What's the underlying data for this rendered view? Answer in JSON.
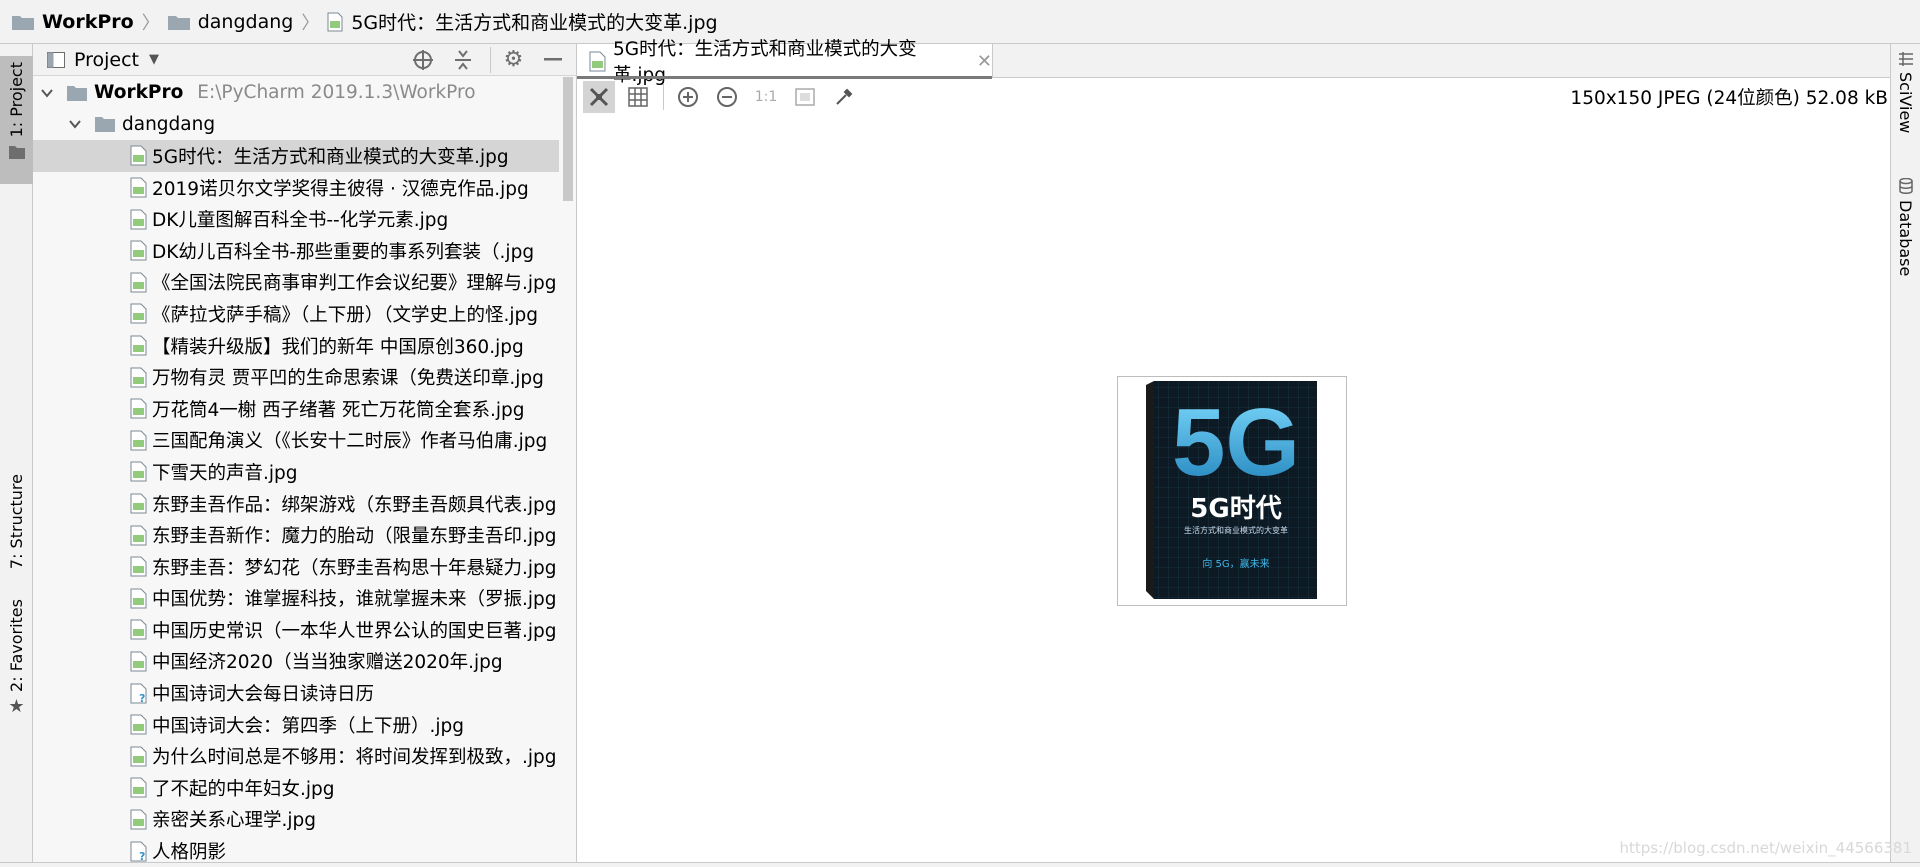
{
  "breadcrumb": {
    "items": [
      "WorkPro",
      "dangdang",
      "5G时代：生活方式和商业模式的大变革.jpg"
    ]
  },
  "left_stripe": {
    "project": "1: Project",
    "structure": "7: Structure",
    "favorites": "2: Favorites"
  },
  "right_stripe": {
    "sciview": "SciView",
    "database": "Database"
  },
  "project_panel": {
    "title": "Project",
    "root_name": "WorkPro",
    "root_path": "E:\\PyCharm 2019.1.3\\WorkPro",
    "folder": "dangdang",
    "files": [
      "5G时代：生活方式和商业模式的大变革.jpg",
      "2019诺贝尔文学奖得主彼得 · 汉德克作品.jpg",
      "DK儿童图解百科全书--化学元素.jpg",
      "DK幼儿百科全书-那些重要的事系列套装（.jpg",
      "《全国法院民商事审判工作会议纪要》理解与.jpg",
      "《萨拉戈萨手稿》（上下册）（文学史上的怪.jpg",
      "【精装升级版】我们的新年 中国原创360.jpg",
      "万物有灵 贾平凹的生命思索课（免费送印章.jpg",
      "万花筒4一榭 西子绪著 死亡万花筒全套系.jpg",
      "三国配角演义（《长安十二时辰》作者马伯庸.jpg",
      "下雪天的声音.jpg",
      "东野圭吾作品：绑架游戏（东野圭吾颇具代表.jpg",
      "东野圭吾新作：魔力的胎动（限量东野圭吾印.jpg",
      "东野圭吾：梦幻花（东野圭吾构思十年悬疑力.jpg",
      "中国优势：谁掌握科技，谁就掌握未来（罗振.jpg",
      "中国历史常识（一本华人世界公认的国史巨著.jpg",
      "中国经济2020（当当独家赠送2020年.jpg",
      "中国诗词大会每日读诗日历",
      "中国诗词大会：第四季（上下册）.jpg",
      "为什么时间总是不够用：将时间发挥到极致，.jpg",
      "了不起的中年妇女.jpg",
      "亲密关系心理学.jpg",
      "人格阴影"
    ],
    "unknown_type_files": [
      17,
      22
    ]
  },
  "editor": {
    "tab_title": "5G时代：生活方式和商业模式的大变革.jpg",
    "zoom_actual_label": "1:1",
    "image_info": "150x150 JPEG (24位颜色) 52.08 kB"
  },
  "cover": {
    "big_text": "5G",
    "title": "5G时代",
    "subtitle": "生活方式和商业模式的大变革",
    "slogan": "向 5G，赢未来"
  },
  "watermark": "https://blog.csdn.net/weixin_44566381",
  "colors": {
    "file_icon": "#5a9bd4",
    "file_icon_green": "#62b543",
    "folder": "#9aa7b0",
    "cover_bg": "#0d1a24",
    "cover_glow": "#3fb8e8"
  }
}
